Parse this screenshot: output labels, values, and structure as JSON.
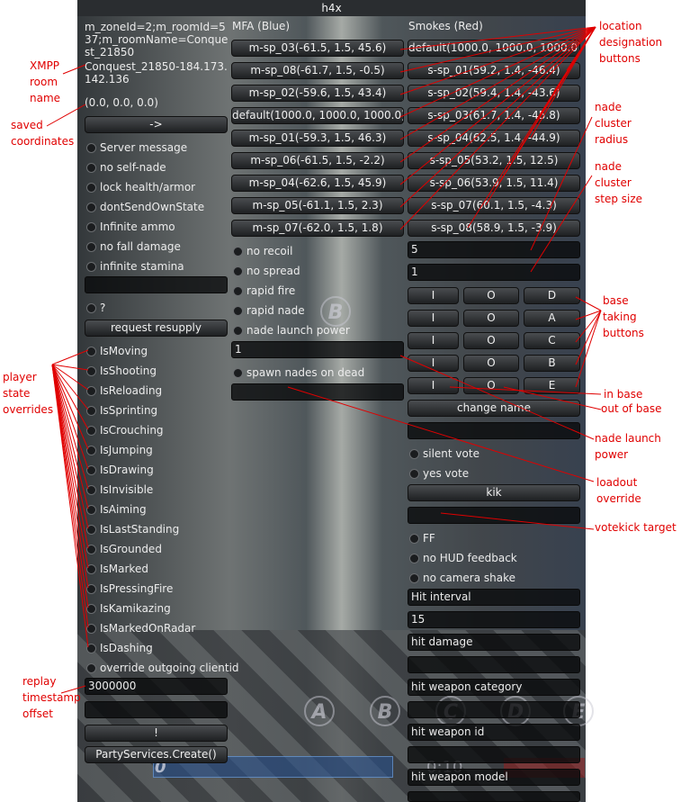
{
  "window": {
    "title": "h4x"
  },
  "left": {
    "room_info": "m_zoneId=2;m_roomId=537;m_roomName=Conquest_21850",
    "room_name": "Conquest_21850-184.173.142.136",
    "saved_coords": "(0.0, 0.0, 0.0)",
    "go_button": "->",
    "toggles_top": [
      "Server message",
      "no self-nade",
      "lock health/armor",
      "dontSendOwnState",
      "Infinite ammo",
      "no fall damage",
      "infinite stamina"
    ],
    "question_toggle": "?",
    "resupply_button": "request resupply",
    "state_toggles": [
      "IsMoving",
      "IsShooting",
      "IsReloading",
      "IsSprinting",
      "IsCrouching",
      "IsJumping",
      "IsDrawing",
      "IsInvisible",
      "IsAiming",
      "IsLastStanding",
      "IsGrounded",
      "IsMarked",
      "IsPressingFire",
      "IsKamikazing",
      "IsMarkedOnRadar",
      "IsDashing"
    ],
    "override_clientid_toggle": "override outgoing clientid",
    "replay_offset_value": "3000000",
    "bang_button": "!",
    "party_button": "PartyServices.Create()"
  },
  "mid": {
    "header": "MFA (Blue)",
    "buttons": [
      "m-sp_03(-61.5, 1.5, 45.6)",
      "m-sp_08(-61.7, 1.5, -0.5)",
      "m-sp_02(-59.6, 1.5, 43.4)",
      "default(1000.0, 1000.0, 1000.0)",
      "m-sp_01(-59.3, 1.5, 46.3)",
      "m-sp_06(-61.5, 1.5, -2.2)",
      "m-sp_04(-62.6, 1.5, 45.9)",
      "m-sp_05(-61.1, 1.5, 2.3)",
      "m-sp_07(-62.0, 1.5, 1.8)"
    ],
    "toggles": [
      "no recoil",
      "no spread",
      "rapid fire",
      "rapid nade",
      "nade launch power"
    ],
    "launch_power_value": "1",
    "spawn_toggle": "spawn nades on dead"
  },
  "right": {
    "header": "Smokes (Red)",
    "buttons": [
      "default(1000.0, 1000.0, 1000.0)",
      "s-sp_01(59.2, 1.4, -46.4)",
      "s-sp_02(59.4, 1.4, -43.6)",
      "s-sp_03(61.7, 1.4, -45.8)",
      "s-sp_04(62.5, 1.4, -44.9)",
      "s-sp_05(53.2, 1.5, 12.5)",
      "s-sp_06(53.9, 1.5, 11.4)",
      "s-sp_07(60.1, 1.5, -4.3)",
      "s-sp_08(58.9, 1.5, -3.9)"
    ],
    "radius_value": "5",
    "step_value": "1",
    "base_rows": [
      {
        "in": "I",
        "out": "O",
        "base": "D"
      },
      {
        "in": "I",
        "out": "O",
        "base": "A"
      },
      {
        "in": "I",
        "out": "O",
        "base": "C"
      },
      {
        "in": "I",
        "out": "O",
        "base": "B"
      },
      {
        "in": "I",
        "out": "O",
        "base": "E"
      }
    ],
    "change_name_button": "change name",
    "silent_vote": "silent vote",
    "yes_vote": "yes vote",
    "kik_button": "kik",
    "ff": "FF",
    "no_hud": "no HUD feedback",
    "no_shake": "no camera shake",
    "hit_interval_label": "Hit interval",
    "hit_interval_value": "15",
    "hit_damage_label": "hit damage",
    "hit_weapon_category_label": "hit weapon category",
    "hit_weapon_id_label": "hit weapon id",
    "hit_weapon_model_label": "hit weapon model"
  },
  "hud": {
    "markers": [
      "A",
      "B",
      "C",
      "D",
      "E"
    ],
    "center_marker": "B",
    "time": "0:10",
    "score": "0"
  },
  "annotations": {
    "xmpp": "XMPP\nroom\nname",
    "saved": "saved\ncoordinates",
    "player_state": "player\nstate\noverrides",
    "replay": "replay\ntimestamp\noffset",
    "location": "location\ndesignation\nbuttons",
    "radius": "nade\ncluster\nradius",
    "step": "nade\ncluster\nstep size",
    "base_taking": "base\ntaking\nbuttons",
    "in_base": "in base",
    "out_base": "out of base",
    "launch_power": "nade launch\npower",
    "loadout": "loadout\noverride",
    "votekick": "votekick target"
  },
  "colors": {
    "annotation": "#e00000",
    "panel_button": "#2e3134",
    "title_bar": "#2a2d30"
  }
}
